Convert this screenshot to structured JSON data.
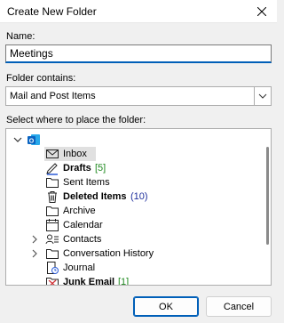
{
  "window": {
    "title": "Create New Folder"
  },
  "name_field": {
    "label": "Name:",
    "value": "Meetings"
  },
  "folder_contains": {
    "label": "Folder contains:",
    "value": "Mail and Post Items"
  },
  "tree": {
    "label": "Select where to place the folder:",
    "items": [
      {
        "label": "Inbox",
        "icon": "envelope-icon",
        "selected": true
      },
      {
        "label": "Drafts",
        "icon": "drafts-pencil-icon",
        "bold": true,
        "count": "[5]"
      },
      {
        "label": "Sent Items",
        "icon": "folder-icon"
      },
      {
        "label": "Deleted Items",
        "icon": "trash-icon",
        "bold": true,
        "count": "(10)"
      },
      {
        "label": "Archive",
        "icon": "folder-icon"
      },
      {
        "label": "Calendar",
        "icon": "calendar-icon"
      },
      {
        "label": "Contacts",
        "icon": "contacts-icon",
        "expandable": true
      },
      {
        "label": "Conversation History",
        "icon": "folder-icon",
        "expandable": true
      },
      {
        "label": "Journal",
        "icon": "journal-icon"
      },
      {
        "label": "Junk Email",
        "icon": "junk-icon",
        "bold": true,
        "count": "[1]"
      }
    ]
  },
  "buttons": {
    "ok": "OK",
    "cancel": "Cancel"
  },
  "colors": {
    "accent": "#005fb8",
    "count_green": "#218a21",
    "count_blue": "#1f2f9c",
    "outlook_blue": "#0a64c2"
  }
}
